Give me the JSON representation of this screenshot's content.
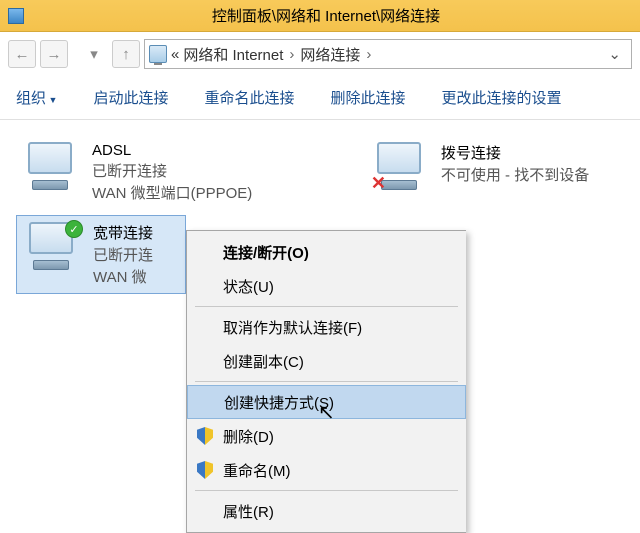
{
  "title": "控制面板\\网络和 Internet\\网络连接",
  "address": {
    "quot": "«",
    "crumb1": "网络和 Internet",
    "crumb2": "网络连接",
    "sep": "›"
  },
  "toolbar": {
    "org": "组织",
    "start": "启动此连接",
    "rename": "重命名此连接",
    "delete": "删除此连接",
    "change": "更改此连接的设置"
  },
  "connections": {
    "adsl": {
      "name": "ADSL",
      "status": "已断开连接",
      "device": "WAN 微型端口(PPPOE)"
    },
    "dial": {
      "name": "拨号连接",
      "status": "不可使用 - 找不到设备"
    },
    "bb": {
      "name": "宽带连接",
      "status": "已断开连",
      "device": "WAN 微"
    }
  },
  "menu": {
    "connect": "连接/断开(O)",
    "status": "状态(U)",
    "unsetdefault": "取消作为默认连接(F)",
    "copy": "创建副本(C)",
    "shortcut": "创建快捷方式(S)",
    "delete": "删除(D)",
    "rename": "重命名(M)",
    "props": "属性(R)"
  }
}
